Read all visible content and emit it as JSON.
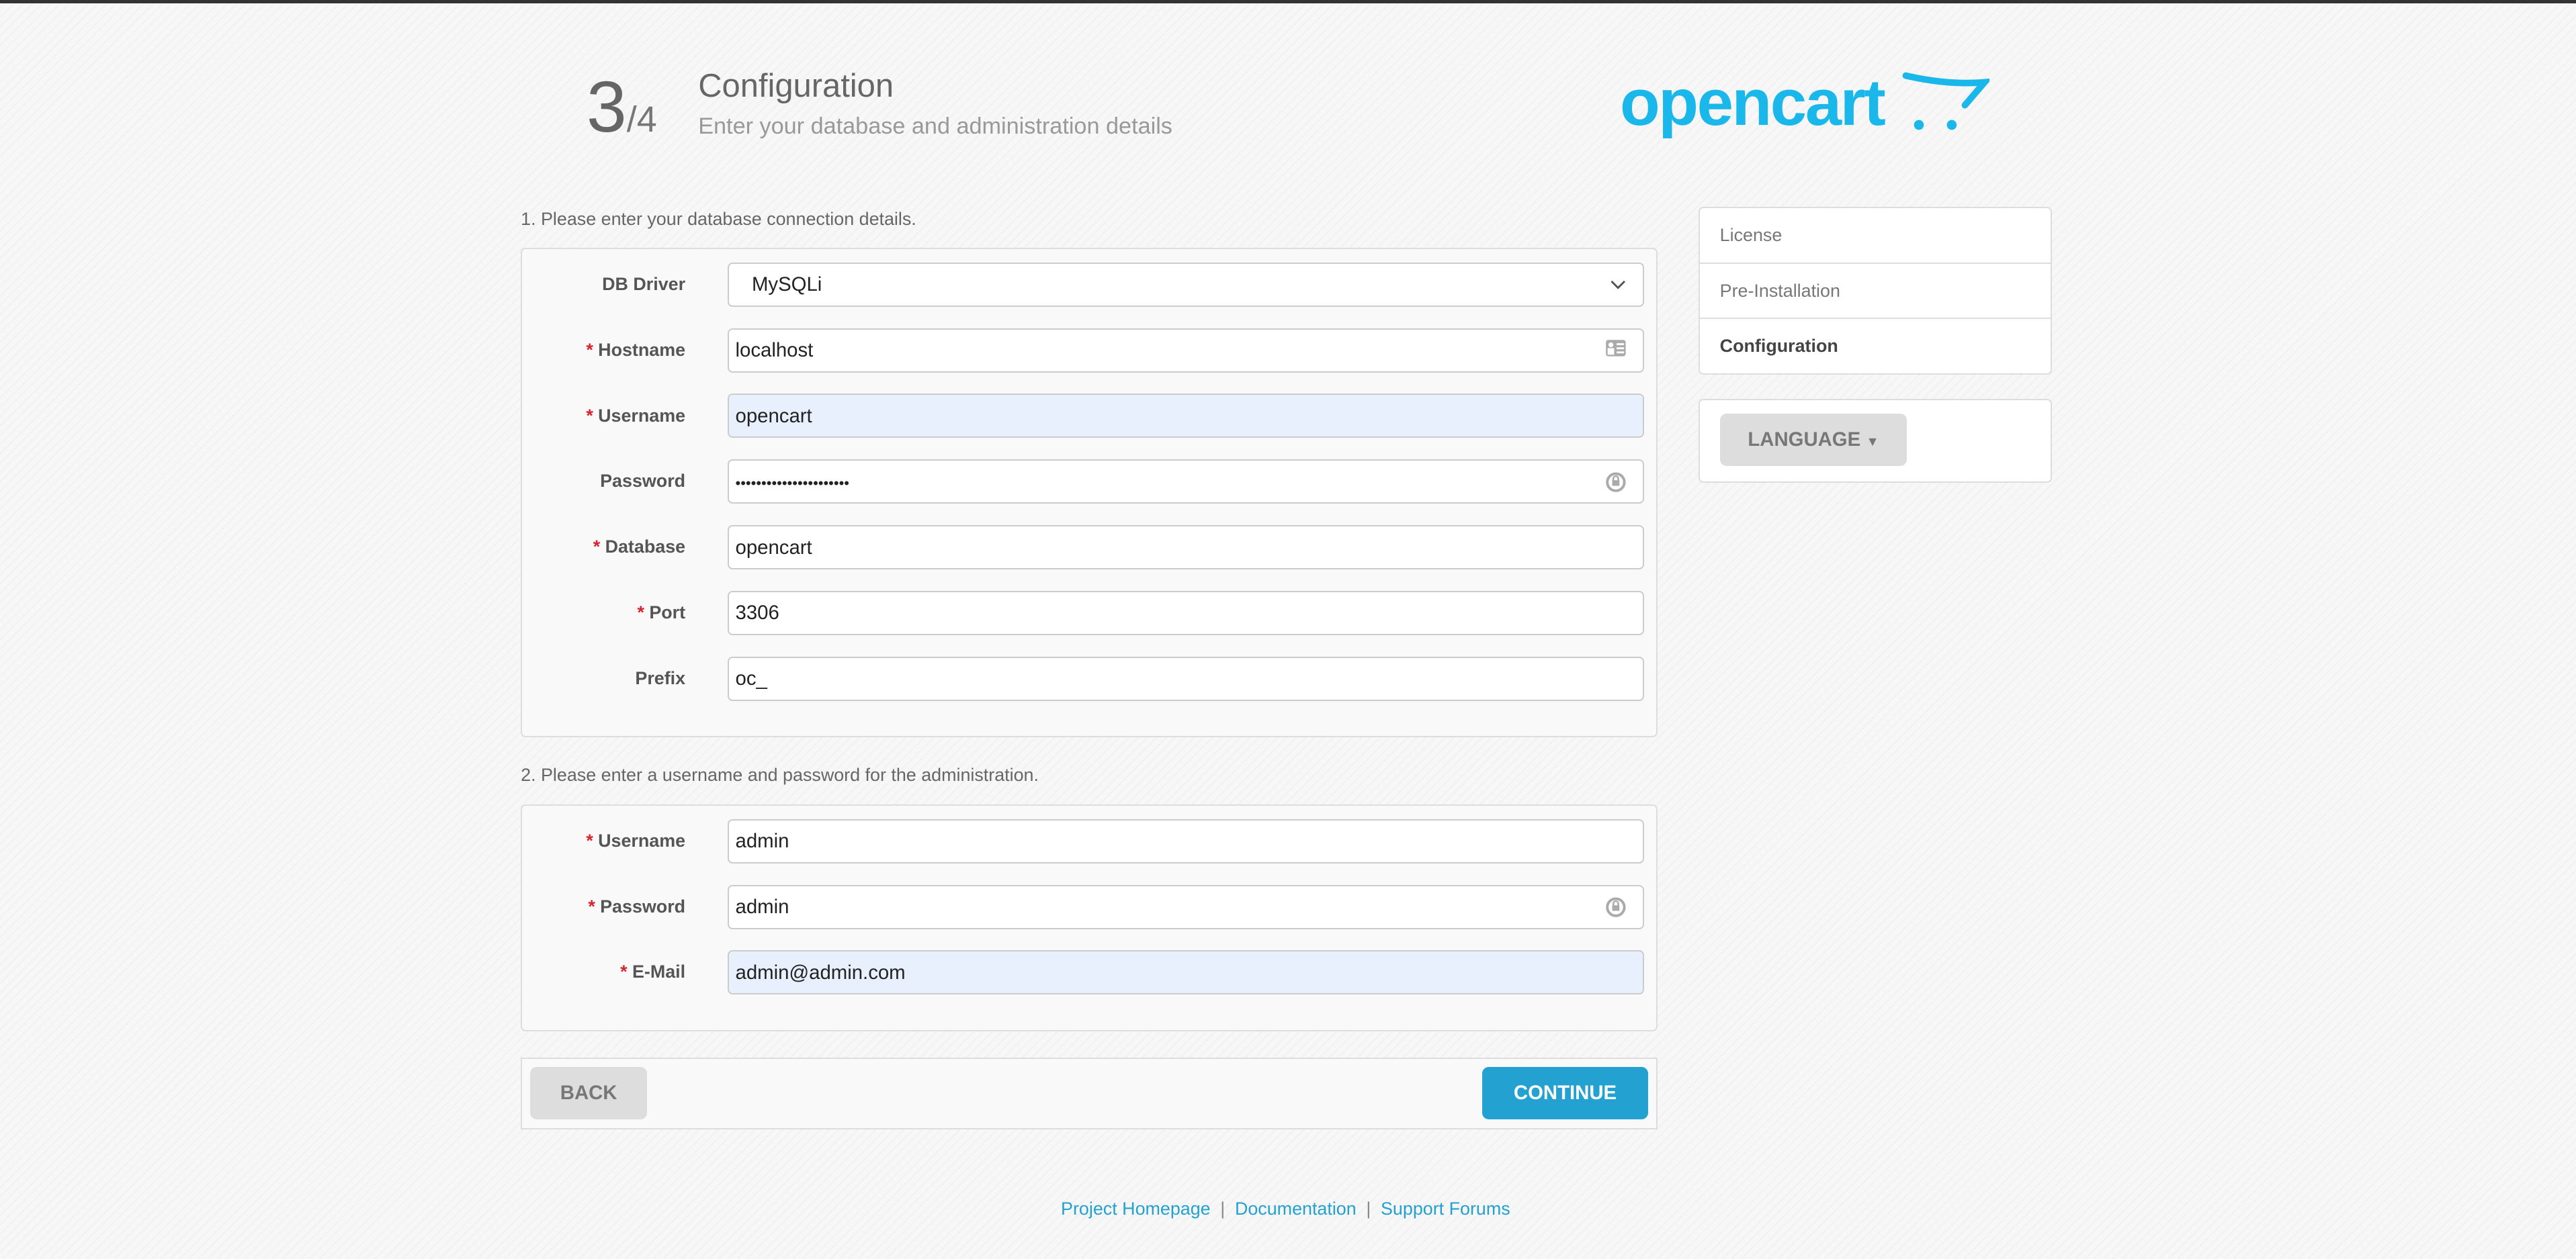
{
  "header": {
    "step": "3",
    "total": "/4",
    "title": "Configuration",
    "subtitle": "Enter your database and administration details",
    "logo_text": "opencart"
  },
  "colors": {
    "accent": "#23a1d1",
    "logo": "#1ab7ea",
    "required": "#d9232d"
  },
  "db_section": {
    "heading": "1. Please enter your database connection details.",
    "fields": [
      {
        "label": "DB Driver",
        "required": false,
        "value": "MySQLi",
        "type": "select",
        "icon": "chevron-down-icon"
      },
      {
        "label": "Hostname",
        "required": true,
        "value": "localhost",
        "icon": "contact-card-icon"
      },
      {
        "label": "Username",
        "required": true,
        "value": "opencart",
        "autofilled": true
      },
      {
        "label": "Password",
        "required": false,
        "value": "••••••••••••••••••••••",
        "icon": "password-lock-icon"
      },
      {
        "label": "Database",
        "required": true,
        "value": "opencart"
      },
      {
        "label": "Port",
        "required": true,
        "value": "3306"
      },
      {
        "label": "Prefix",
        "required": false,
        "value": "oc_"
      }
    ]
  },
  "admin_section": {
    "heading": "2. Please enter a username and password for the administration.",
    "fields": [
      {
        "label": "Username",
        "required": true,
        "value": "admin"
      },
      {
        "label": "Password",
        "required": true,
        "value": "admin",
        "icon": "password-lock-icon"
      },
      {
        "label": "E-Mail",
        "required": true,
        "value": "admin@admin.com",
        "autofilled": true
      }
    ]
  },
  "buttons": {
    "back": "BACK",
    "continue": "CONTINUE"
  },
  "sidebar": {
    "steps": [
      {
        "label": "License"
      },
      {
        "label": "Pre-Installation"
      },
      {
        "label": "Configuration",
        "active": true
      }
    ],
    "language": "LANGUAGE"
  },
  "footer": {
    "links": [
      "Project Homepage",
      "Documentation",
      "Support Forums"
    ],
    "separator": "|"
  }
}
